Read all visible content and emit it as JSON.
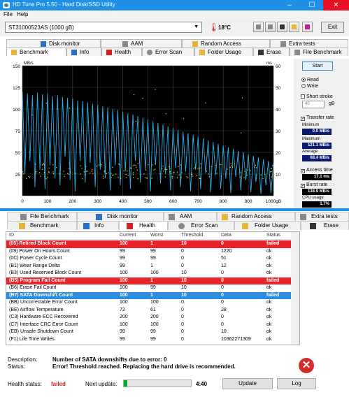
{
  "window": {
    "title": "HD Tune Pro 5.50 - Hard Disk/SSD Utility",
    "minimize": "–",
    "maximize": "☐",
    "close": "✕"
  },
  "menu": {
    "file": "File",
    "help": "Help"
  },
  "toolbar": {
    "drive": "ST31000523AS (1000 gB)",
    "temperature": "18°C",
    "exit": "Exit",
    "icons": [
      "copy-icon",
      "copy-text-icon",
      "camera-icon",
      "options-icon",
      "save-icon"
    ]
  },
  "upper_tabs": {
    "row1": [
      "Disk monitor",
      "AAM",
      "Random Access",
      "Extra tests"
    ],
    "row2": [
      "Benchmark",
      "Info",
      "Health",
      "Error Scan",
      "Folder Usage",
      "Erase",
      "File Benchmark"
    ],
    "active": "Benchmark"
  },
  "benchmark": {
    "start": "Start",
    "read": "Read",
    "write": "Write",
    "short_stroke": "Short stroke",
    "stroke_value": "40",
    "stroke_unit": "gB",
    "transfer_rate": "Transfer rate",
    "minimum_label": "Minimum",
    "minimum": "0.0 MB/s",
    "maximum_label": "Maximum",
    "maximum": "121.1 MB/s",
    "average_label": "Average",
    "average": "68.4 MB/s",
    "access_time_label": "Access time",
    "access_time": "17.1 ms",
    "burst_rate_label": "Burst rate",
    "burst_rate": "138.9 MB/s",
    "cpu_label": "CPU usage",
    "cpu": "1.7%"
  },
  "chart_data": {
    "type": "line",
    "ylabel": "MB/s",
    "y2label": "ms",
    "xlabel": "gB",
    "yticks": [
      "150",
      "125",
      "100",
      "75",
      "50",
      "25"
    ],
    "y2ticks": [
      "60",
      "50",
      "40",
      "30",
      "20",
      "10"
    ],
    "xticks": [
      "0",
      "100",
      "200",
      "300",
      "400",
      "500",
      "600",
      "700",
      "800",
      "900",
      "1000gB"
    ],
    "xlim": [
      0,
      1000
    ],
    "ylim": [
      0,
      150
    ],
    "y2lim": [
      0,
      60
    ],
    "series": [
      {
        "name": "Transfer rate",
        "color": "#2ab0e8",
        "x": [
          0,
          10,
          20,
          30,
          40,
          50,
          60,
          70,
          80,
          90,
          100,
          110,
          120,
          130,
          140,
          150,
          160,
          170,
          180,
          190,
          200,
          210,
          220,
          230,
          240,
          250,
          260,
          270,
          280,
          290,
          300,
          310,
          320,
          330,
          340,
          350,
          360,
          370,
          380,
          390,
          400,
          410,
          420,
          430,
          440,
          450,
          460,
          470,
          480,
          490,
          500,
          510,
          520,
          530,
          540,
          550,
          560,
          570,
          580,
          590,
          600,
          610,
          620,
          630,
          640,
          650,
          660,
          670,
          680,
          690,
          700,
          710,
          720,
          730,
          740,
          750,
          760,
          770,
          780,
          790,
          800,
          810,
          820,
          830,
          840,
          850,
          860,
          870,
          880,
          890,
          900,
          910,
          920,
          930,
          940,
          950,
          960,
          970,
          980,
          990,
          1000
        ],
        "y": [
          120,
          25,
          118,
          40,
          116,
          10,
          119,
          30,
          117,
          8,
          118,
          35,
          115,
          20,
          116,
          12,
          114,
          45,
          113,
          18,
          112,
          5,
          110,
          40,
          109,
          15,
          108,
          38,
          106,
          10,
          105,
          30,
          103,
          22,
          102,
          6,
          100,
          35,
          99,
          12,
          97,
          28,
          95,
          8,
          94,
          40,
          92,
          15,
          90,
          30,
          88,
          5,
          86,
          36,
          84,
          14,
          82,
          25,
          80,
          6,
          78,
          32,
          76,
          10,
          74,
          28,
          72,
          5,
          70,
          30,
          68,
          8,
          66,
          26,
          64,
          4,
          62,
          24,
          60,
          8,
          58,
          20,
          56,
          3,
          54,
          22,
          52,
          6,
          50,
          18,
          48,
          4,
          46,
          16,
          44,
          2,
          42,
          12,
          40,
          3,
          38
        ]
      },
      {
        "name": "Access time",
        "color": "#f0e040",
        "type": "scatter"
      }
    ]
  },
  "lower_tabs": {
    "row1": [
      "File Benchmark",
      "Disk monitor",
      "AAM",
      "Random Access",
      "Extra tests"
    ],
    "row2": [
      "Benchmark",
      "Info",
      "Health",
      "Error Scan",
      "Folder Usage",
      "Erase"
    ],
    "active": "Health"
  },
  "smart": {
    "columns": [
      "ID",
      "Current",
      "Worst",
      "Threshold",
      "Data",
      "Status"
    ],
    "rows": [
      {
        "id": "(05) Retired Block Count",
        "current": "100",
        "worst": "1",
        "threshold": "10",
        "data": "0",
        "status": "failed",
        "style": "fail"
      },
      {
        "id": "(09) Power On Hours Count",
        "current": "99",
        "worst": "99",
        "threshold": "0",
        "data": "1220",
        "status": "ok",
        "style": ""
      },
      {
        "id": "(0C) Power Cycle Count",
        "current": "99",
        "worst": "99",
        "threshold": "0",
        "data": "51",
        "status": "ok",
        "style": ""
      },
      {
        "id": "(B1) Wear Range Delta",
        "current": "99",
        "worst": "1",
        "threshold": "0",
        "data": "12",
        "status": "ok",
        "style": ""
      },
      {
        "id": "(B3) Used Reserved Block Count",
        "current": "100",
        "worst": "100",
        "threshold": "10",
        "data": "0",
        "status": "ok",
        "style": ""
      },
      {
        "id": "(B5) Program Fail Count",
        "current": "100",
        "worst": "1",
        "threshold": "10",
        "data": "0",
        "status": "failed",
        "style": "fail"
      },
      {
        "id": "(B6) Erase Fail Count",
        "current": "100",
        "worst": "99",
        "threshold": "10",
        "data": "0",
        "status": "ok",
        "style": ""
      },
      {
        "id": "(B7) SATA Downshift Count",
        "current": "100",
        "worst": "1",
        "threshold": "10",
        "data": "0",
        "status": "failed",
        "style": "sel"
      },
      {
        "id": "(BB) Uncorrectable Error Count",
        "current": "100",
        "worst": "100",
        "threshold": "0",
        "data": "0",
        "status": "ok",
        "style": ""
      },
      {
        "id": "(BE) Airflow Temperature",
        "current": "72",
        "worst": "61",
        "threshold": "0",
        "data": "28",
        "status": "ok",
        "style": ""
      },
      {
        "id": "(C3) Hardware ECC Recovered",
        "current": "200",
        "worst": "200",
        "threshold": "0",
        "data": "0",
        "status": "ok",
        "style": ""
      },
      {
        "id": "(C7) Interface CRC Error Count",
        "current": "100",
        "worst": "100",
        "threshold": "0",
        "data": "0",
        "status": "ok",
        "style": ""
      },
      {
        "id": "(EB) Unsafe Shutdown Count",
        "current": "99",
        "worst": "99",
        "threshold": "0",
        "data": "10",
        "status": "ok",
        "style": ""
      },
      {
        "id": "(F1) Life Time Writes",
        "current": "99",
        "worst": "99",
        "threshold": "0",
        "data": "10362271309",
        "status": "ok",
        "style": ""
      }
    ]
  },
  "details": {
    "description_label": "Description:",
    "description": "Number of SATA downshifts due to error: 0",
    "status_label": "Status:",
    "status": "Error! Threshold reached. Replacing the hard drive is recommended."
  },
  "statusbar": {
    "health_label": "Health status:",
    "health": "failed",
    "next_update_label": "Next update:",
    "progress": 0.05,
    "countdown": "4:40",
    "update": "Update",
    "log": "Log"
  }
}
